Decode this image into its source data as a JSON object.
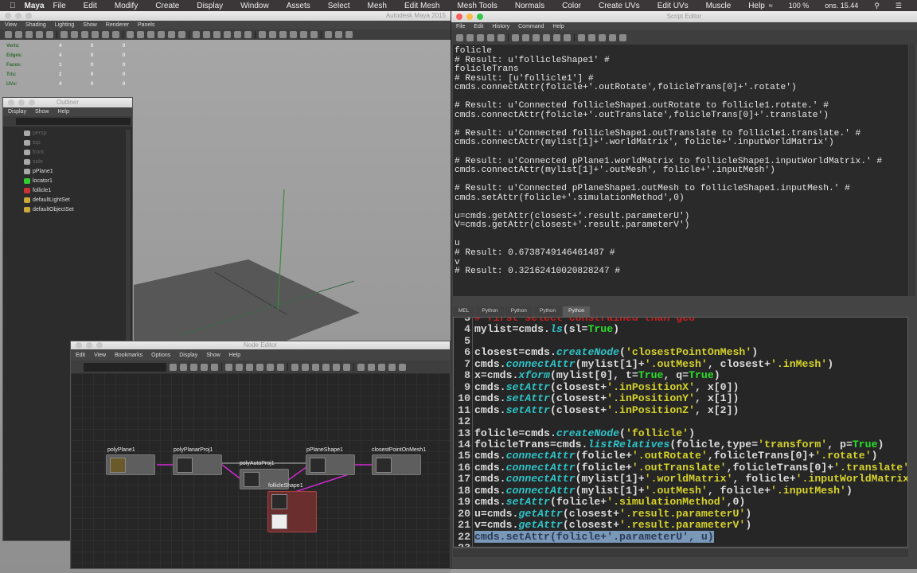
{
  "mac_menubar": {
    "app": "Maya",
    "items": [
      "File",
      "Edit",
      "Modify",
      "Create",
      "Display",
      "Window",
      "Assets",
      "Select",
      "Mesh",
      "Edit Mesh",
      "Mesh Tools",
      "Normals",
      "Color",
      "Create UVs",
      "Edit UVs",
      "Muscle",
      "Help"
    ],
    "battery": "100 %",
    "clock": "ons. 15.44"
  },
  "maya": {
    "title": "Autodesk Maya 2015",
    "panel_menu": [
      "View",
      "Shading",
      "Lighting",
      "Show",
      "Renderer",
      "Panels"
    ],
    "hud": [
      {
        "label": "Verts:",
        "values": [
          "4",
          "0",
          "0"
        ]
      },
      {
        "label": "Edges:",
        "values": [
          "4",
          "0",
          "0"
        ]
      },
      {
        "label": "Faces:",
        "values": [
          "1",
          "0",
          "0"
        ]
      },
      {
        "label": "Tris:",
        "values": [
          "2",
          "0",
          "0"
        ]
      },
      {
        "label": "UVs:",
        "values": [
          "4",
          "0",
          "0"
        ]
      }
    ]
  },
  "outliner": {
    "title": "Outliner",
    "menu": [
      "Display",
      "Show",
      "Help"
    ],
    "items": [
      {
        "label": "persp",
        "dim": true,
        "icon": "camera-icon"
      },
      {
        "label": "top",
        "dim": true,
        "icon": "camera-icon"
      },
      {
        "label": "front",
        "dim": true,
        "icon": "camera-icon"
      },
      {
        "label": "side",
        "dim": true,
        "icon": "camera-icon"
      },
      {
        "label": "pPlane1",
        "dim": false,
        "icon": "transform-icon"
      },
      {
        "label": "locator1",
        "dim": false,
        "icon": "locator-icon"
      },
      {
        "label": "follicle1",
        "dim": false,
        "icon": "follicle-icon"
      },
      {
        "label": "defaultLightSet",
        "dim": false,
        "icon": "set-icon"
      },
      {
        "label": "defaultObjectSet",
        "dim": false,
        "icon": "set-icon"
      }
    ]
  },
  "node_editor": {
    "title": "Node Editor",
    "menu": [
      "Edit",
      "View",
      "Bookmarks",
      "Options",
      "Display",
      "Show",
      "Help"
    ],
    "nodes": {
      "polyPlane1": "polyPlane1",
      "polyPlanarProj1": "polyPlanarProj1",
      "polyAutoProj1": "polyAutoProj1",
      "pPlaneShape1": "pPlaneShape1",
      "closestPointOnMesh1": "closestPointOnMesh1",
      "follicleShape1": "follicleShape1"
    }
  },
  "script_editor": {
    "title": "Script Editor",
    "menu": [
      "File",
      "Edit",
      "History",
      "Command",
      "Help"
    ],
    "output": [
      "folicle",
      "# Result: u'follicleShape1' #",
      "folicleTrans",
      "# Result: [u'follicle1'] #",
      "cmds.connectAttr(folicle+'.outRotate',folicleTrans[0]+'.rotate')",
      "",
      "# Result: u'Connected follicleShape1.outRotate to follicle1.rotate.' #",
      "cmds.connectAttr(folicle+'.outTranslate',folicleTrans[0]+'.translate')",
      "",
      "# Result: u'Connected follicleShape1.outTranslate to follicle1.translate.' #",
      "cmds.connectAttr(mylist[1]+'.worldMatrix', folicle+'.inputWorldMatrix')",
      "",
      "# Result: u'Connected pPlane1.worldMatrix to follicleShape1.inputWorldMatrix.' #",
      "cmds.connectAttr(mylist[1]+'.outMesh', folicle+'.inputMesh')",
      "",
      "# Result: u'Connected pPlaneShape1.outMesh to follicleShape1.inputMesh.' #",
      "cmds.setAttr(folicle+'.simulationMethod',0)",
      "",
      "u=cmds.getAttr(closest+'.result.parameterU')",
      "V=cmds.getAttr(closest+'.result.parameterV')",
      "",
      "u",
      "# Result: 0.6738749146461487 #",
      "v",
      "# Result: 0.32162410020828247 #"
    ],
    "tabs": [
      "MEL",
      "Python",
      "Python",
      "Python",
      "Python"
    ],
    "active_tab": 4,
    "code": [
      {
        "n": "3",
        "t": [
          [
            "cm",
            "# first select constrained than geo"
          ]
        ]
      },
      {
        "n": "4",
        "t": [
          [
            "",
            "mylist=cmds."
          ],
          [
            "fn",
            "ls"
          ],
          [
            "",
            "(sl="
          ],
          [
            "true",
            "True"
          ],
          [
            "",
            ")"
          ]
        ]
      },
      {
        "n": "5",
        "t": []
      },
      {
        "n": "6",
        "t": [
          [
            "",
            "closest=cmds."
          ],
          [
            "fn",
            "createNode"
          ],
          [
            "",
            "("
          ],
          [
            "str",
            "'closestPointOnMesh'"
          ],
          [
            "",
            ")"
          ]
        ]
      },
      {
        "n": "7",
        "t": [
          [
            "",
            "cmds."
          ],
          [
            "fn",
            "connectAttr"
          ],
          [
            "",
            "(mylist[1]+"
          ],
          [
            "str",
            "'.outMesh'"
          ],
          [
            "",
            ", closest+"
          ],
          [
            "str",
            "'.inMesh'"
          ],
          [
            "",
            ")"
          ]
        ]
      },
      {
        "n": "8",
        "t": [
          [
            "",
            "x=cmds."
          ],
          [
            "fn",
            "xform"
          ],
          [
            "",
            "(mylist[0], t="
          ],
          [
            "true",
            "True"
          ],
          [
            "",
            ", q="
          ],
          [
            "true",
            "True"
          ],
          [
            "",
            ")"
          ]
        ]
      },
      {
        "n": "9",
        "t": [
          [
            "",
            "cmds."
          ],
          [
            "fn",
            "setAttr"
          ],
          [
            "",
            "(closest+"
          ],
          [
            "str",
            "'.inPositionX'"
          ],
          [
            "",
            ", x[0])"
          ]
        ]
      },
      {
        "n": "10",
        "t": [
          [
            "",
            "cmds."
          ],
          [
            "fn",
            "setAttr"
          ],
          [
            "",
            "(closest+"
          ],
          [
            "str",
            "'.inPositionY'"
          ],
          [
            "",
            ", x[1])"
          ]
        ]
      },
      {
        "n": "11",
        "t": [
          [
            "",
            "cmds."
          ],
          [
            "fn",
            "setAttr"
          ],
          [
            "",
            "(closest+"
          ],
          [
            "str",
            "'.inPositionZ'"
          ],
          [
            "",
            ", x[2])"
          ]
        ]
      },
      {
        "n": "12",
        "t": []
      },
      {
        "n": "13",
        "t": [
          [
            "",
            "folicle=cmds."
          ],
          [
            "fn",
            "createNode"
          ],
          [
            "",
            "("
          ],
          [
            "str",
            "'follicle'"
          ],
          [
            "",
            ")"
          ]
        ]
      },
      {
        "n": "14",
        "t": [
          [
            "",
            "folicleTrans=cmds."
          ],
          [
            "fn",
            "listRelatives"
          ],
          [
            "",
            "(folicle,type="
          ],
          [
            "str",
            "'transform'"
          ],
          [
            "",
            ", p="
          ],
          [
            "true",
            "True"
          ],
          [
            "",
            ")"
          ]
        ]
      },
      {
        "n": "15",
        "t": [
          [
            "",
            "cmds."
          ],
          [
            "fn",
            "connectAttr"
          ],
          [
            "",
            "(folicle+"
          ],
          [
            "str",
            "'.outRotate'"
          ],
          [
            "",
            ",folicleTrans[0]+"
          ],
          [
            "str",
            "'.rotate'"
          ],
          [
            "",
            ")"
          ]
        ]
      },
      {
        "n": "16",
        "t": [
          [
            "",
            "cmds."
          ],
          [
            "fn",
            "connectAttr"
          ],
          [
            "",
            "(folicle+"
          ],
          [
            "str",
            "'.outTranslate'"
          ],
          [
            "",
            ",folicleTrans[0]+"
          ],
          [
            "str",
            "'.translate'"
          ],
          [
            "",
            ")"
          ]
        ]
      },
      {
        "n": "17",
        "t": [
          [
            "",
            "cmds."
          ],
          [
            "fn",
            "connectAttr"
          ],
          [
            "",
            "(mylist[1]+"
          ],
          [
            "str",
            "'.worldMatrix'"
          ],
          [
            "",
            ", folicle+"
          ],
          [
            "str",
            "'.inputWorldMatrix'"
          ],
          [
            "",
            ")"
          ]
        ]
      },
      {
        "n": "18",
        "t": [
          [
            "",
            "cmds."
          ],
          [
            "fn",
            "connectAttr"
          ],
          [
            "",
            "(mylist[1]+"
          ],
          [
            "str",
            "'.outMesh'"
          ],
          [
            "",
            ", folicle+"
          ],
          [
            "str",
            "'.inputMesh'"
          ],
          [
            "",
            ")"
          ]
        ]
      },
      {
        "n": "19",
        "t": [
          [
            "",
            "cmds."
          ],
          [
            "fn",
            "setAttr"
          ],
          [
            "",
            "(folicle+"
          ],
          [
            "str",
            "'.simulationMethod'"
          ],
          [
            "",
            ",0)"
          ]
        ]
      },
      {
        "n": "20",
        "t": [
          [
            "",
            "u=cmds."
          ],
          [
            "fn",
            "getAttr"
          ],
          [
            "",
            "(closest+"
          ],
          [
            "str",
            "'.result.parameterU'"
          ],
          [
            "",
            ")"
          ]
        ]
      },
      {
        "n": "21",
        "t": [
          [
            "",
            "v=cmds."
          ],
          [
            "fn",
            "getAttr"
          ],
          [
            "",
            "(closest+"
          ],
          [
            "str",
            "'.result.parameterV'"
          ],
          [
            "",
            ")"
          ]
        ]
      },
      {
        "n": "22",
        "sel": true,
        "t": [
          [
            "",
            "cmds.setAttr(folicle+'.parameterU', u)"
          ]
        ]
      },
      {
        "n": "23",
        "t": []
      }
    ]
  }
}
